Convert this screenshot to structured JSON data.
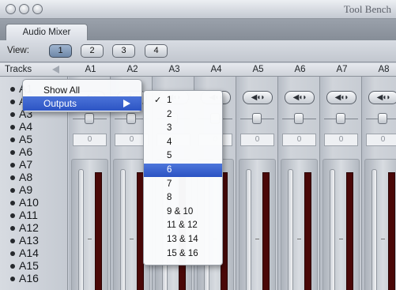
{
  "window": {
    "title": "Tool Bench"
  },
  "tab": {
    "label": "Audio Mixer"
  },
  "view": {
    "label": "View:",
    "buttons": [
      "1",
      "2",
      "3",
      "4"
    ],
    "selected": "1"
  },
  "tracks_header": "Tracks",
  "tracks": [
    "A1",
    "A2",
    "A3",
    "A4",
    "A5",
    "A6",
    "A7",
    "A8",
    "A9",
    "A10",
    "A11",
    "A12",
    "A13",
    "A14",
    "A15",
    "A16"
  ],
  "columns": [
    "A1",
    "A2",
    "A3",
    "A4",
    "A5",
    "A6",
    "A7",
    "A8"
  ],
  "strip_value": "0",
  "context_menu": {
    "items": [
      "Show All",
      "Outputs"
    ],
    "highlighted": "Outputs"
  },
  "outputs_menu": {
    "items": [
      "1",
      "2",
      "3",
      "4",
      "5",
      "6",
      "7",
      "8",
      "9 & 10",
      "11 & 12",
      "13 & 14",
      "15 & 16"
    ],
    "checked": "1",
    "highlighted": "6",
    "check_glyph": "✓"
  },
  "colors": {
    "meter": "#4a0808",
    "highlight": "#2d55c4"
  }
}
